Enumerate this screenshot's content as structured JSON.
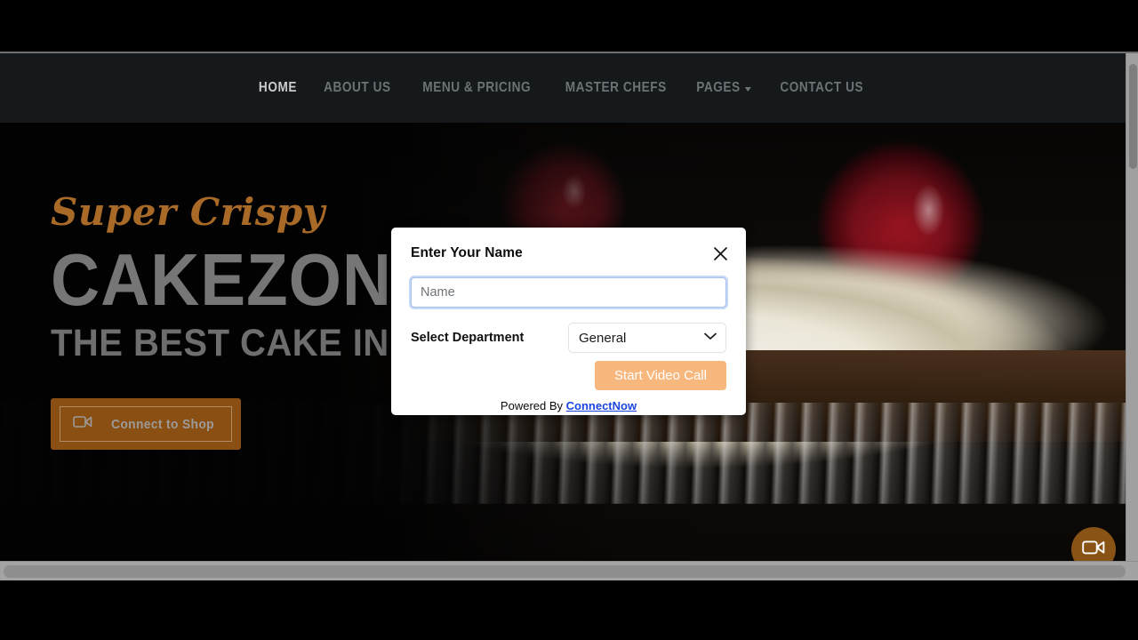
{
  "nav": {
    "items": [
      {
        "label": "HOME",
        "active": true,
        "caret": false
      },
      {
        "label": "ABOUT US",
        "active": false,
        "caret": false
      },
      {
        "label": "MENU & PRICING",
        "active": false,
        "caret": false
      },
      {
        "label": "MASTER CHEFS",
        "active": false,
        "caret": false
      },
      {
        "label": "PAGES",
        "active": false,
        "caret": true
      },
      {
        "label": "CONTACT US",
        "active": false,
        "caret": false
      }
    ]
  },
  "hero": {
    "script_text": "Super Crispy",
    "title": "CAKEZONE",
    "subtitle": "THE BEST CAKE IN LONDON",
    "cta_label": "Connect to Shop",
    "cta_icon": "video-camera-icon",
    "script_color": "#a96a28",
    "title_color": "#767676",
    "cta_bg": "#8a4f13"
  },
  "modal": {
    "title": "Enter Your Name",
    "close_icon": "close-icon",
    "name_placeholder": "Name",
    "name_value": "",
    "department_label": "Select Department",
    "department_selected": "General",
    "department_options": [
      "General"
    ],
    "start_button_label": "Start Video Call",
    "start_button_color": "#f8b77c",
    "powered_prefix": "Powered By ",
    "powered_link": "ConnectNow",
    "powered_link_color": "#1a45e0"
  },
  "fab": {
    "icon": "video-camera-icon",
    "color": "#8a5316"
  }
}
